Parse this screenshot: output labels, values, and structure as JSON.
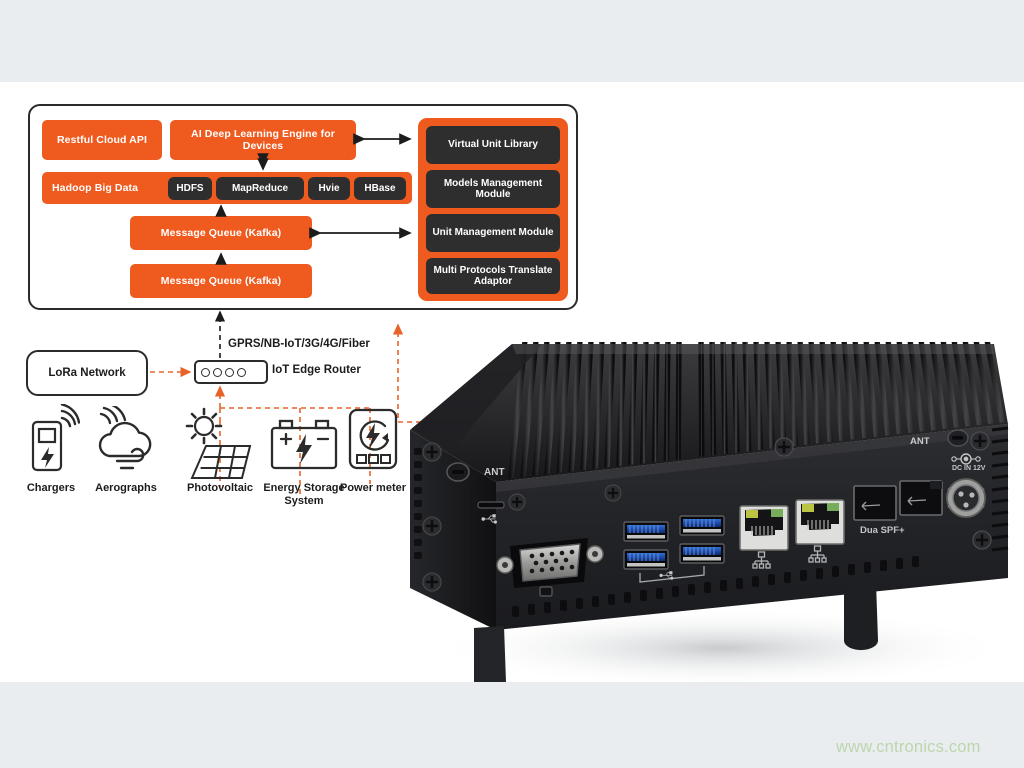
{
  "theme": {
    "orange": "#ef5a1e",
    "dark_box": "#2e2e2e",
    "band": "#e9edf0",
    "line": "#2b2b2b",
    "dashed_orange": "#e8632a",
    "watermark_color": "#bdd6ad"
  },
  "architecture_panel": {
    "cloud_layer": [
      {
        "id": "restful",
        "label": "Restful Cloud API"
      },
      {
        "id": "ai",
        "label": "AI Deep Learning Engine for Devices"
      }
    ],
    "bigdata_layer": {
      "label": "Hadoop Big Data",
      "components": [
        {
          "id": "hdfs",
          "label": "HDFS"
        },
        {
          "id": "mapreduce",
          "label": "MapReduce"
        },
        {
          "id": "hvie",
          "label": "Hvie"
        },
        {
          "id": "hbase",
          "label": "HBase"
        }
      ]
    },
    "queues": [
      {
        "id": "mq1",
        "label": "Message Queue (Kafka)"
      },
      {
        "id": "mq2",
        "label": "Message Queue (Kafka)"
      }
    ],
    "right_stack": [
      {
        "id": "virtual-unit-library",
        "label": "Virtual Unit Library"
      },
      {
        "id": "models-management-module",
        "label": "Models Management Module"
      },
      {
        "id": "unit-management-module",
        "label": "Unit Management Module"
      },
      {
        "id": "multi-protocols-translate-adaptor",
        "label": "Multi Protocols Translate Adaptor"
      }
    ]
  },
  "network_layer": {
    "lora_label": "LoRa Network",
    "router_label": "IoT Edge Router",
    "uplink_label": "GPRS/NB-IoT/3G/4G/Fiber",
    "router_led_count": 4
  },
  "devices": [
    {
      "id": "chargers",
      "label": "Chargers",
      "icon": "ev-charger-icon"
    },
    {
      "id": "aerographs",
      "label": "Aerographs",
      "icon": "weather-cloud-wind-icon"
    },
    {
      "id": "photovoltaic",
      "label": "Photovoltaic",
      "icon": "solar-panel-icon"
    },
    {
      "id": "energy-storage-system",
      "label": "Energy Storage System",
      "icon": "battery-icon"
    },
    {
      "id": "power-meter",
      "label": "Power meter",
      "icon": "power-meter-icon"
    }
  ],
  "device_photo": {
    "alt": "Fanless industrial edge computer, front I/O panel",
    "port_labels": [
      {
        "id": "ant-left",
        "label": "ANT"
      },
      {
        "id": "ant-right",
        "label": "ANT"
      },
      {
        "id": "dual-sfp",
        "label": "Dua  SPF+"
      },
      {
        "id": "dc-in",
        "label": "DC IN 12V"
      }
    ]
  },
  "watermark": "www.cntronics.com"
}
